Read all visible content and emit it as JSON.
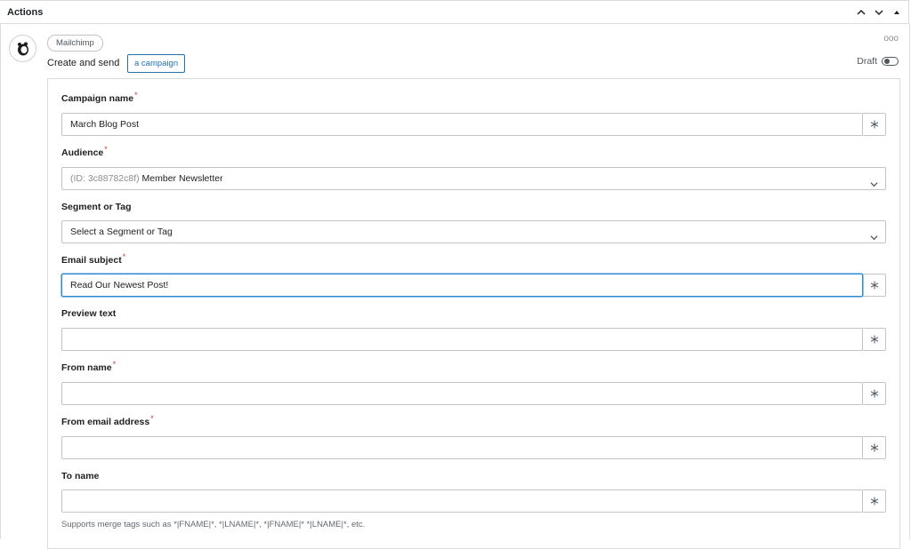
{
  "header": {
    "title": "Actions"
  },
  "action": {
    "app_pill": "Mailchimp",
    "headline_prefix": "Create and send",
    "headline_button": "a campaign",
    "more_icon": "ooo",
    "draft_label": "Draft"
  },
  "fields": {
    "campaign_name": {
      "label": "Campaign name",
      "required": "*",
      "value": "March Blog Post"
    },
    "audience": {
      "label": "Audience",
      "required": "*",
      "value_prefix": "(ID: 3c88782c8f)",
      "value": "Member Newsletter"
    },
    "segment": {
      "label": "Segment or Tag",
      "value": "Select a Segment or Tag"
    },
    "email_subject": {
      "label": "Email subject",
      "required": "*",
      "value": "Read Our Newest Post!"
    },
    "preview_text": {
      "label": "Preview text",
      "value": ""
    },
    "from_name": {
      "label": "From name",
      "required": "*",
      "value": ""
    },
    "from_email": {
      "label": "From email address",
      "required": "*",
      "value": ""
    },
    "to_name": {
      "label": "To name",
      "value": "",
      "help": "Supports merge tags such as *|FNAME|*, *|LNAME|*, *|FNAME|* *|LNAME|*, etc."
    }
  },
  "icons": {
    "collapse_up": "chevron-up-icon",
    "expand_down": "chevron-down-icon",
    "move_top": "triangle-up-icon",
    "insert_tag": "asterisk-icon",
    "dropdown": "chevron-down-icon",
    "logo": "mailchimp-logo-icon"
  },
  "colors": {
    "accent": "#2271b1",
    "focus": "#2c8ad1",
    "required": "#d63638"
  }
}
